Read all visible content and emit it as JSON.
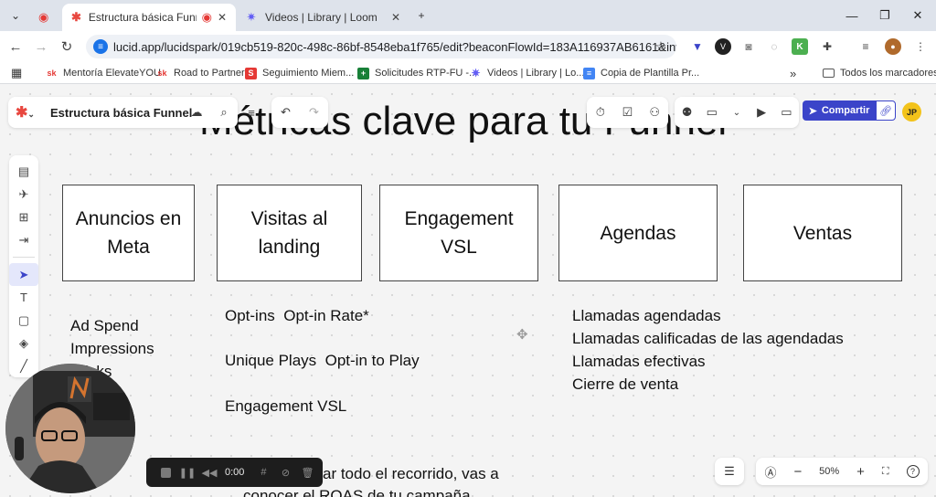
{
  "browser": {
    "tabs": [
      {
        "title": "Estructura básica Funnel: Lu",
        "active": true
      },
      {
        "title": "Videos | Library | Loom",
        "active": false
      }
    ],
    "new_tab": "+",
    "url": "lucid.app/lucidspark/019cb519-820c-498c-86bf-8548eba1f765/edit?beaconFlowId=183A116937AB6161&invitationI...",
    "bookmarks": [
      {
        "label": "Mentoría ElevateYOU",
        "icon": "sk",
        "color": "#e53935"
      },
      {
        "label": "Road to Partner",
        "icon": "sk",
        "color": "#e53935"
      },
      {
        "label": "Seguimiento Miem...",
        "icon": "S",
        "color": "#e53935"
      },
      {
        "label": "Solicitudes RTP-FU -...",
        "icon": "+",
        "color": "#188038"
      },
      {
        "label": "Videos | Library | Lo...",
        "icon": "✷",
        "color": "#625df5"
      },
      {
        "label": "Copia de Plantilla Pr...",
        "icon": "≡",
        "color": "#4285f4"
      }
    ],
    "bookmarks_more": "»",
    "all_bookmarks": "Todos los marcadores"
  },
  "app": {
    "doc_title": "Estructura básica Funnel",
    "share_label": "Compartir",
    "avatar_initials": "JP",
    "zoom": "50%"
  },
  "board": {
    "title": "Métricas clave para tu Funnel",
    "stages": [
      "Anuncios en Meta",
      "Visitas al landing",
      "Engagement VSL",
      "Agendas",
      "Ventas"
    ],
    "meta_metrics": [
      "Ad Spend",
      "Impressions",
      "Clicks"
    ],
    "landing_metrics": [
      "Opt-ins  Opt-in Rate*",
      "Unique Plays  Opt-in to Play",
      "Engagement VSL"
    ],
    "agenda_metrics": [
      "Llamadas agendadas",
      "Llamadas calificadas de las agendadas",
      "Llamadas efectivas",
      "Cierre de venta"
    ],
    "footer_text_1": "ar todo el recorrido, vas a",
    "footer_text_2": "conocer el ROAS de tu campaña"
  },
  "recorder": {
    "time": "0:00"
  },
  "colors": {
    "accent": "#3b44c9",
    "lucid_red": "#e8473f",
    "avatar": "#f3c31b"
  }
}
